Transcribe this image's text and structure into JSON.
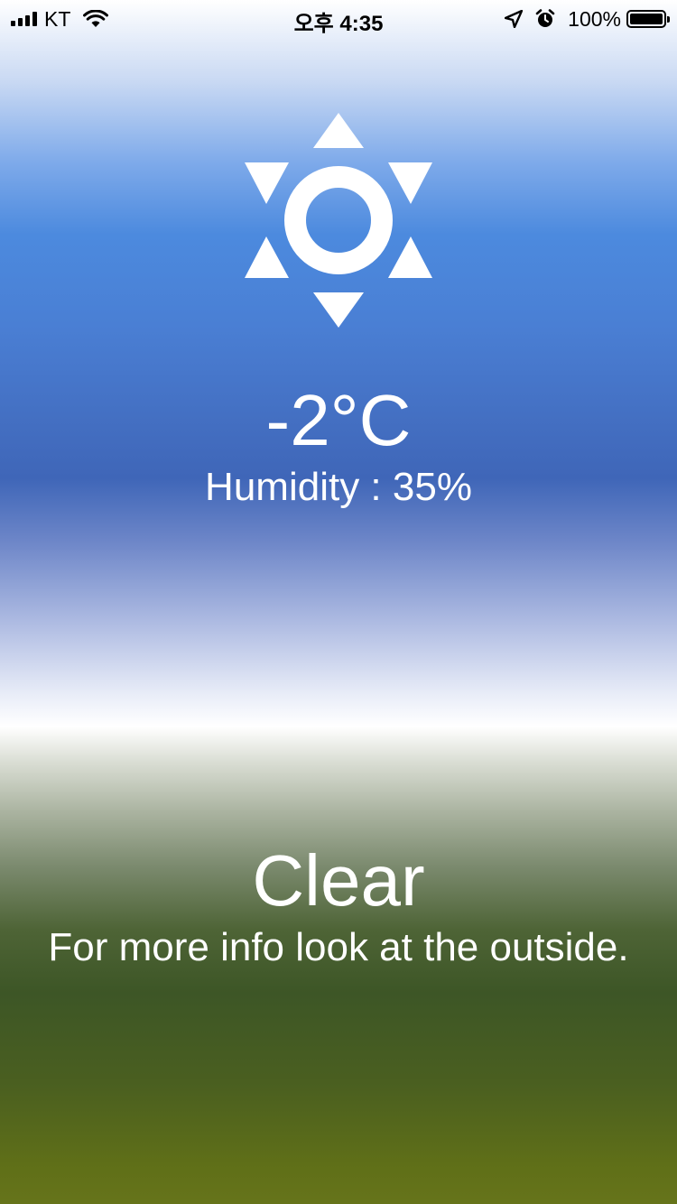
{
  "status_bar": {
    "carrier": "KT",
    "time": "오후 4:35",
    "battery_percent": "100%",
    "battery_level": 1.0,
    "icons": [
      "signal-icon",
      "wifi-icon",
      "location-arrow-icon",
      "alarm-clock-icon",
      "battery-icon"
    ]
  },
  "weather": {
    "icon": "sun-icon",
    "temperature": "-2°C",
    "humidity_label": "Humidity : ",
    "humidity_value": "35%",
    "condition": "Clear",
    "description": "For more info look at the outside."
  },
  "colors": {
    "sky_blue": "#4a7fd4",
    "grass_green": "#3d5626",
    "text": "#ffffff"
  }
}
